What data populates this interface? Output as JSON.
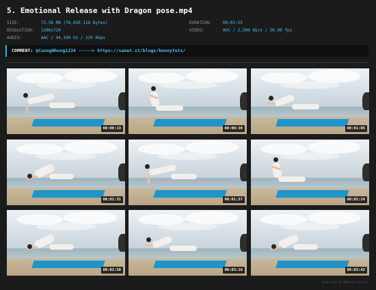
{
  "header": {
    "title": "5. Emotional Release with Dragon pose.mp4"
  },
  "meta_left": [
    {
      "key": "SIZE:",
      "value": "72.58 MB (76,020,116 Bytes)"
    },
    {
      "key": "RESOLUTION:",
      "value": "1280x720"
    },
    {
      "key": "AUDIO:",
      "value": "AAC / 44,100 Hz / 129 Kbps"
    }
  ],
  "meta_right": [
    {
      "key": "DURATION:",
      "value": "00:03:55"
    },
    {
      "key": "VIDEO:",
      "value": "AVC / 2,500 kb/s / 30.00 fps"
    }
  ],
  "comment": {
    "label": "COMMENT:",
    "text": "@CuongNhung1234 -----> https://sanet.st/blogs/bonnytuts/"
  },
  "thumbnails": [
    {
      "timestamp": "00:00:13",
      "pose": "tabletop"
    },
    {
      "timestamp": "00:00:39",
      "pose": "kneel-upright"
    },
    {
      "timestamp": "00:01:05",
      "pose": "lunge-low"
    },
    {
      "timestamp": "00:01:31",
      "pose": "fold-forward"
    },
    {
      "timestamp": "00:01:57",
      "pose": "tabletop"
    },
    {
      "timestamp": "00:02:24",
      "pose": "kneel-upright"
    },
    {
      "timestamp": "00:02:50",
      "pose": "fold-forward"
    },
    {
      "timestamp": "00:03:16",
      "pose": "lunge-low"
    },
    {
      "timestamp": "00:03:42",
      "pose": "fold-forward"
    }
  ],
  "footer": {
    "text": "Generated by AnMovie.net/Cms"
  },
  "colors": {
    "background": "#1b1b1b",
    "accent": "#4fc3f7",
    "label": "#9a9a9a"
  }
}
